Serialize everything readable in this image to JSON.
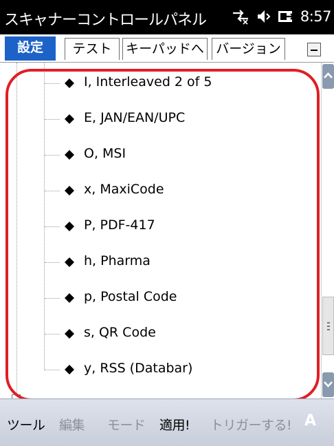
{
  "titlebar": {
    "title": "スキャナーコントロールパネル",
    "time": "8:57",
    "icons": [
      "connectivity-icon",
      "volume-icon",
      "battery-icon"
    ]
  },
  "tabs": [
    {
      "label": "設定",
      "active": true
    },
    {
      "label": "テスト",
      "active": false
    },
    {
      "label": "キーパッドへ",
      "active": false
    },
    {
      "label": "バージョン",
      "active": false
    }
  ],
  "tree": {
    "items": [
      "I, Interleaved 2 of 5",
      "E, JAN/EAN/UPC",
      "O, MSI",
      "x, MaxiCode",
      "P, PDF-417",
      "h, Pharma",
      "p, Postal Code",
      "s, QR Code",
      "y, RSS (Databar)"
    ]
  },
  "commands": {
    "tools": "ツール",
    "edit": "編集",
    "mode": "モード",
    "apply": "適用!",
    "trigger": "トリガーする!",
    "keyboard": "A"
  },
  "colors": {
    "titlebar_bg": "#000000",
    "active_tab": "#1d62c8",
    "highlight": "#e01e24",
    "cmdbar_bg": "#d4d9e3"
  }
}
